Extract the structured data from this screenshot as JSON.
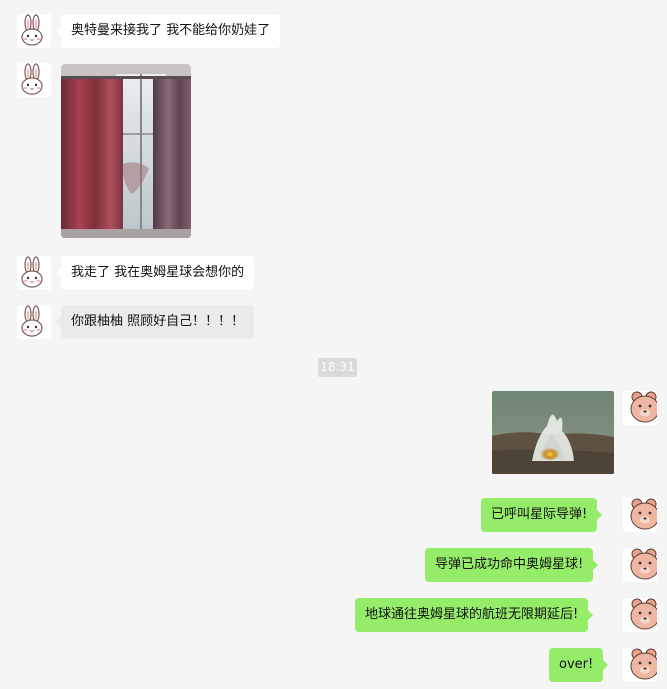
{
  "messages": [
    {
      "side": "left",
      "type": "text",
      "text": "奥特曼来接我了 我不能给你奶娃了"
    },
    {
      "side": "left",
      "type": "image",
      "image_desc": "curtain-window-photo"
    },
    {
      "side": "left",
      "type": "text",
      "text": "我走了 我在奥姆星球会想你的"
    },
    {
      "side": "left",
      "type": "text",
      "text": "你跟柚柚 照顾好自己！！！！"
    },
    {
      "type": "timestamp",
      "text": "18:31"
    },
    {
      "side": "right",
      "type": "image",
      "image_desc": "explosion-gif"
    },
    {
      "side": "right",
      "type": "text",
      "text": "已呼叫星际导弹!"
    },
    {
      "side": "right",
      "type": "text",
      "text": "导弹已成功命中奥姆星球!"
    },
    {
      "side": "right",
      "type": "text",
      "text": "地球通往奥姆星球的航班无限期延后!"
    },
    {
      "side": "right",
      "type": "text",
      "text": "over!"
    }
  ],
  "colors": {
    "background": "#f5f5f5",
    "left_bubble": "#ffffff",
    "left_bubble_selected": "#ebebeb",
    "right_bubble": "#95ec69",
    "timestamp_bg": "#dadada"
  },
  "icons": {
    "left_avatar": "bunny-avatar-icon",
    "right_avatar": "bear-avatar-icon"
  }
}
